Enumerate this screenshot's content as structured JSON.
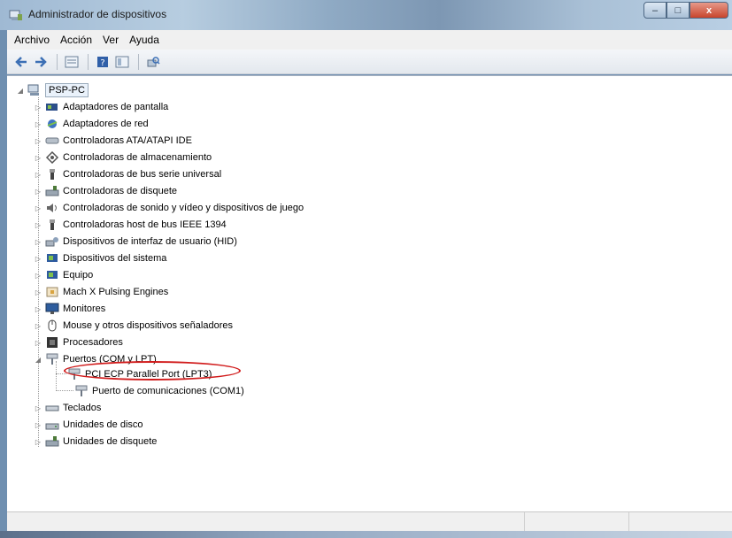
{
  "window": {
    "title": "Administrador de dispositivos",
    "controls": {
      "minimize": "–",
      "maximize": "□",
      "close": "x"
    }
  },
  "menu": [
    "Archivo",
    "Acción",
    "Ver",
    "Ayuda"
  ],
  "toolbar": [
    "back-arrow-icon",
    "forward-arrow-icon",
    "properties-icon",
    "help-icon",
    "view-icon",
    "scan-hardware-icon"
  ],
  "tree": {
    "root": "PSP-PC",
    "categories": [
      {
        "label": "Adaptadores de pantalla",
        "icon": "display-adapter-icon"
      },
      {
        "label": "Adaptadores de red",
        "icon": "network-adapter-icon"
      },
      {
        "label": "Controladoras ATA/ATAPI IDE",
        "icon": "ide-controller-icon"
      },
      {
        "label": "Controladoras de almacenamiento",
        "icon": "storage-controller-icon"
      },
      {
        "label": "Controladoras de bus serie universal",
        "icon": "usb-icon"
      },
      {
        "label": "Controladoras de disquete",
        "icon": "floppy-controller-icon"
      },
      {
        "label": "Controladoras de sonido y vídeo y dispositivos de juego",
        "icon": "sound-icon"
      },
      {
        "label": "Controladoras host de bus IEEE 1394",
        "icon": "ieee1394-icon"
      },
      {
        "label": "Dispositivos de interfaz de usuario (HID)",
        "icon": "hid-icon"
      },
      {
        "label": "Dispositivos del sistema",
        "icon": "system-device-icon"
      },
      {
        "label": "Equipo",
        "icon": "computer-icon"
      },
      {
        "label": "Mach X Pulsing Engines",
        "icon": "mach-engine-icon"
      },
      {
        "label": "Monitores",
        "icon": "monitor-icon"
      },
      {
        "label": "Mouse y otros dispositivos señaladores",
        "icon": "mouse-icon"
      },
      {
        "label": "Procesadores",
        "icon": "processor-icon"
      },
      {
        "label": "Puertos (COM y LPT)",
        "icon": "port-icon",
        "expanded": true,
        "children": [
          {
            "label": "PCI ECP Parallel Port (LPT3)",
            "icon": "port-icon",
            "highlighted": true
          },
          {
            "label": "Puerto de comunicaciones (COM1)",
            "icon": "port-icon"
          }
        ]
      },
      {
        "label": "Teclados",
        "icon": "keyboard-icon"
      },
      {
        "label": "Unidades de disco",
        "icon": "disk-drive-icon"
      },
      {
        "label": "Unidades de disquete",
        "icon": "floppy-drive-icon"
      }
    ]
  },
  "colors": {
    "highlight_circle": "#d11b1b"
  }
}
